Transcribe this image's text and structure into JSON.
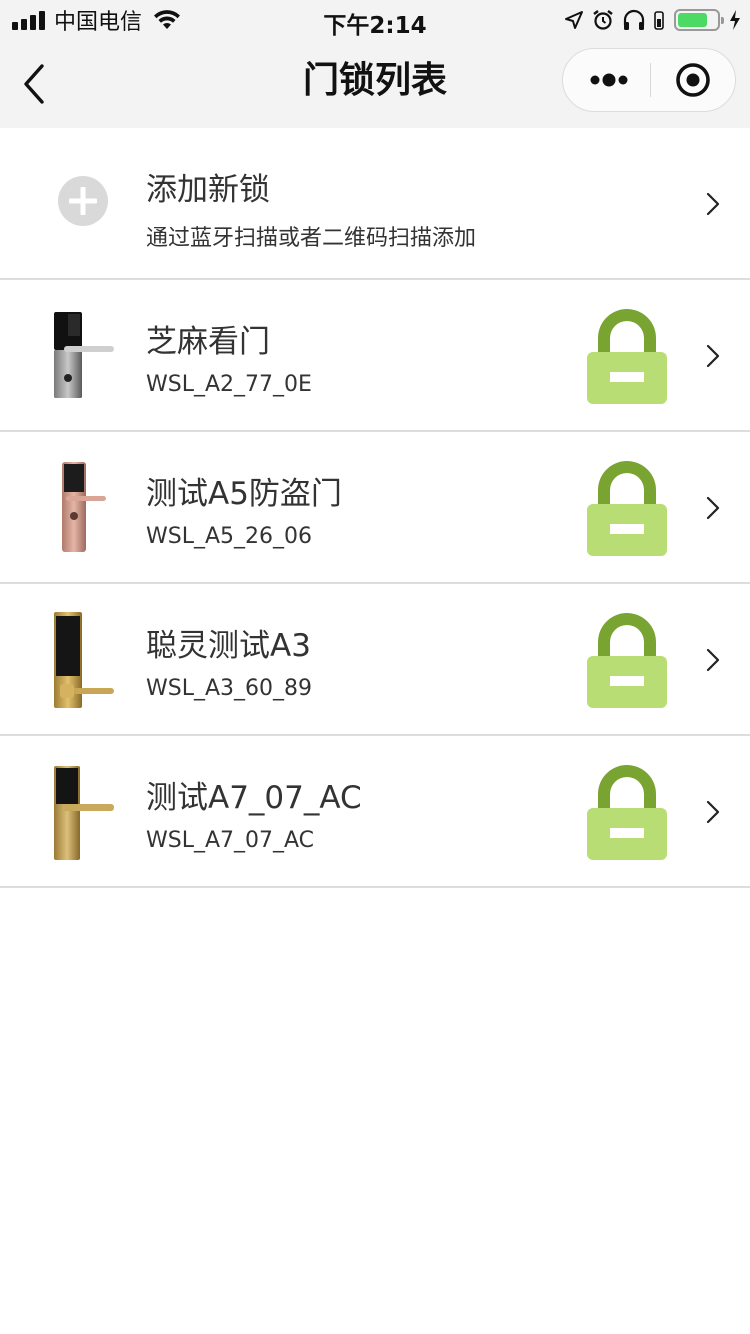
{
  "status_bar": {
    "carrier": "中国电信",
    "time": "下午2:14"
  },
  "nav": {
    "title": "门锁列表"
  },
  "add_lock": {
    "title": "添加新锁",
    "subtitle": "通过蓝牙扫描或者二维码扫描添加"
  },
  "locks": [
    {
      "name": "芝麻看门",
      "id": "WSL_A2_77_0E",
      "status": "locked"
    },
    {
      "name": "测试A5防盗门",
      "id": "WSL_A5_26_06",
      "status": "locked"
    },
    {
      "name": "聪灵测试A3",
      "id": "WSL_A3_60_89",
      "status": "locked"
    },
    {
      "name": "测试A7_07_AC",
      "id": "WSL_A7_07_AC",
      "status": "locked"
    }
  ],
  "colors": {
    "lock_body": "#b7dd74",
    "lock_shackle": "#79a431",
    "battery": "#4cd964",
    "bar_bg": "#f3f3f3"
  }
}
